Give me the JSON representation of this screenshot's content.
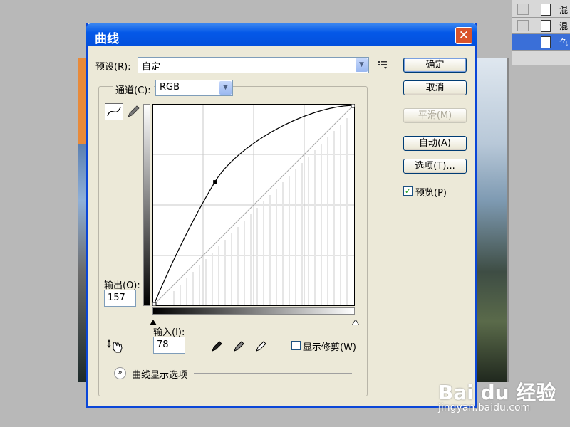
{
  "dialog": {
    "title": "曲线",
    "close_label": "✕"
  },
  "preset": {
    "label": "预设(R):",
    "value": "自定",
    "menu_icon": "list-menu-icon"
  },
  "channel": {
    "label": "通道(C):",
    "value": "RGB"
  },
  "buttons": {
    "ok": "确定",
    "cancel": "取消",
    "smooth": "平滑(M)",
    "auto": "自动(A)",
    "options": "选项(T)..."
  },
  "preview": {
    "label": "预览(P)",
    "checked": true
  },
  "output": {
    "label": "输出(O):",
    "value": "157"
  },
  "input": {
    "label": "输入(I):",
    "value": "78"
  },
  "show_clipping": {
    "label": "显示修剪(W)",
    "checked": false
  },
  "curve_options": {
    "label": "曲线显示选项"
  },
  "curve": {
    "control_point": {
      "input": 78,
      "output": 157
    },
    "range": [
      0,
      255
    ]
  },
  "layers": [
    {
      "name": "混"
    },
    {
      "name": "混"
    },
    {
      "name": "色"
    }
  ],
  "watermark": {
    "brand": "Bai du 经验",
    "url": "jingyan.baidu.com"
  }
}
